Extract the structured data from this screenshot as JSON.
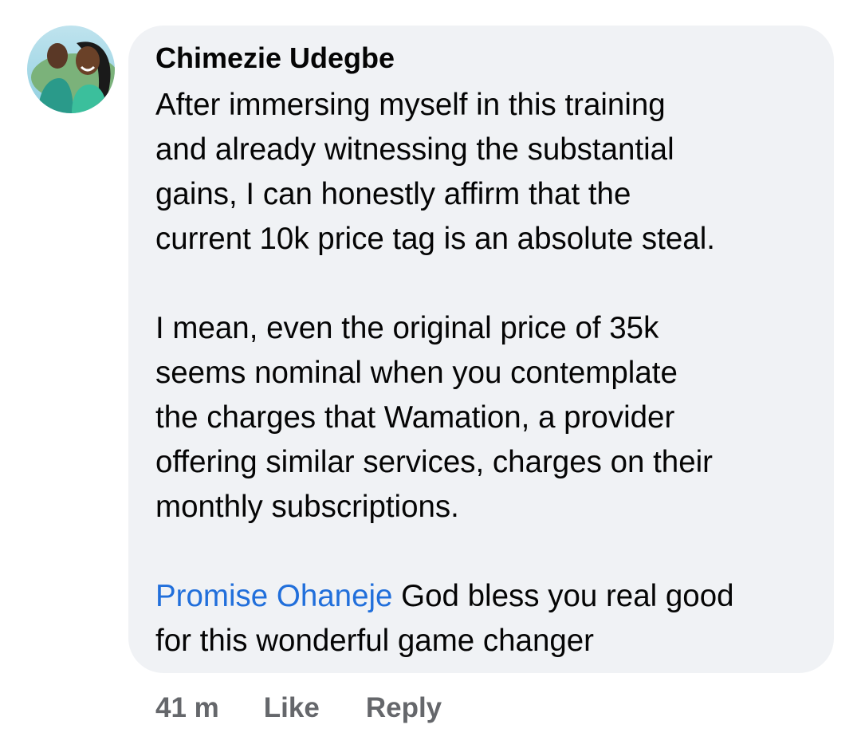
{
  "comment": {
    "author": "Chimezie Udegbe",
    "paragraphs": [
      [
        "After immersing myself in this training",
        "and already witnessing the substantial",
        "gains, I can honestly affirm that the",
        "current 10k price tag is an absolute steal."
      ],
      [
        "I mean, even the original price of 35k",
        "seems nominal when you contemplate",
        "the charges that Wamation, a provider",
        "offering similar services, charges on their",
        "monthly subscriptions."
      ]
    ],
    "mention": "Promise Ohaneje",
    "mention_text_line1": " God bless you real good",
    "mention_text_line2": "for this wonderful game changer"
  },
  "actions": {
    "time": "41 m",
    "like": "Like",
    "reply": "Reply"
  },
  "colors": {
    "bubble": "#f0f2f5",
    "mention": "#216fdb",
    "meta": "#65676b"
  },
  "icons": {
    "avatar": "profile-photo"
  }
}
